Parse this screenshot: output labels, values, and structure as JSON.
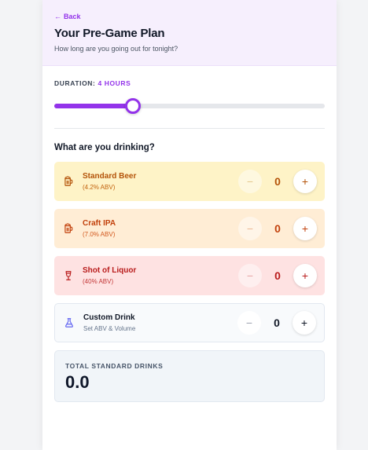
{
  "header": {
    "back_label": "Back",
    "title": "Your Pre-Game Plan",
    "subtitle": "How long are you going out for tonight?"
  },
  "duration": {
    "label": "DURATION:",
    "value_label": "4 HOURS",
    "hours": 4,
    "fill_fraction": 0.29
  },
  "drinks_section": {
    "heading": "What are you drinking?",
    "items": [
      {
        "name": "Standard Beer",
        "detail": "(4.2% ABV)",
        "count": "0",
        "icon": "beer-mug-icon",
        "minus": "−",
        "plus": "+"
      },
      {
        "name": "Craft IPA",
        "detail": "(7.0% ABV)",
        "count": "0",
        "icon": "beer-mug-icon",
        "minus": "−",
        "plus": "+"
      },
      {
        "name": "Shot of Liquor",
        "detail": "(40% ABV)",
        "count": "0",
        "icon": "wine-glass-icon",
        "minus": "−",
        "plus": "+"
      },
      {
        "name": "Custom Drink",
        "detail": "Set ABV & Volume",
        "count": "0",
        "icon": "flask-icon",
        "minus": "−",
        "plus": "+"
      }
    ]
  },
  "total": {
    "label": "TOTAL STANDARD DRINKS",
    "value": "0.0"
  },
  "colors": {
    "accent": "#9333ea",
    "beer": "#b45309",
    "ipa": "#c2410c",
    "liquor": "#b91c1c",
    "custom_icon": "#6366f1"
  }
}
